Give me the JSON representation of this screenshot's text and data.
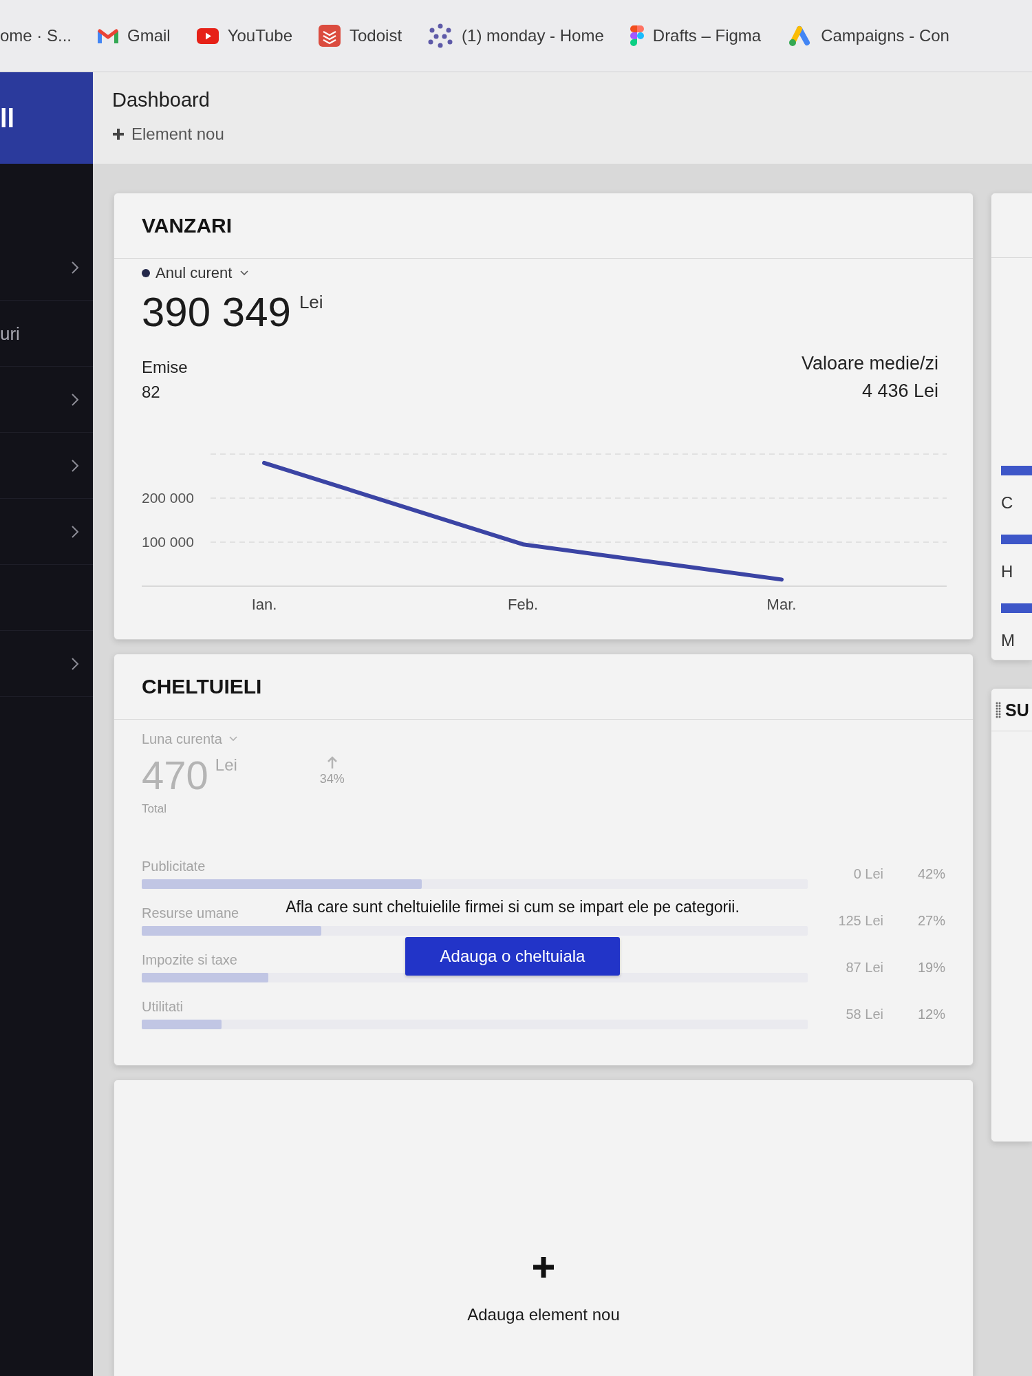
{
  "bookmarks": [
    {
      "kind": "plain",
      "label": "ome · S..."
    },
    {
      "kind": "mail",
      "label": "Gmail"
    },
    {
      "kind": "video",
      "label": "YouTube"
    },
    {
      "kind": "tasks",
      "label": "Todoist"
    },
    {
      "kind": "board",
      "label": "(1) monday - Home"
    },
    {
      "kind": "design",
      "label": "Drafts – Figma"
    },
    {
      "kind": "ads",
      "label": "Campaigns - Con"
    }
  ],
  "sidebar": {
    "brand": "ll",
    "items": [
      {
        "kind": "group"
      },
      {
        "kind": "link",
        "label": "uri"
      },
      {
        "kind": "group"
      },
      {
        "kind": "group"
      },
      {
        "kind": "group"
      },
      {
        "kind": "blank"
      },
      {
        "kind": "group"
      }
    ]
  },
  "header": {
    "title": "Dashboard",
    "add_label": "Element nou"
  },
  "sales": {
    "title": "VANZARI",
    "period": "Anul curent",
    "amount": "390 349",
    "currency": "Lei",
    "issued_label": "Emise",
    "issued_value": "82",
    "avg_label": "Valoare medie/zi",
    "avg_value": "4 436 Lei",
    "chart_data": {
      "type": "line",
      "categories": [
        "Ian.",
        "Feb.",
        "Mar."
      ],
      "values": [
        280000,
        95000,
        15000
      ],
      "ylim": [
        0,
        300000
      ],
      "yticks": [
        {
          "value": 100000,
          "label": "100 000"
        },
        {
          "value": 200000,
          "label": "200 000"
        }
      ]
    }
  },
  "expenses": {
    "title": "CHELTUIELI",
    "preview": {
      "period": "Luna curenta",
      "amount": "470",
      "currency": "Lei",
      "change": "34%",
      "total_label": "Total",
      "categories": [
        {
          "name": "Publicitate",
          "value": "0 Lei",
          "percent": "42%",
          "level": 0.42
        },
        {
          "name": "Resurse umane",
          "value": "125 Lei",
          "percent": "27%",
          "level": 0.27
        },
        {
          "name": "Impozite si taxe",
          "value": "87 Lei",
          "percent": "19%",
          "level": 0.19
        },
        {
          "name": "Utilitati",
          "value": "58 Lei",
          "percent": "12%",
          "level": 0.12
        }
      ]
    },
    "message": "Afla care sunt cheltuielile firmei si cum se impart ele pe categorii.",
    "button": "Adauga o cheltuiala"
  },
  "add_card": {
    "label": "Adauga element nou"
  },
  "right_column": {
    "top_card": {
      "items": [
        {
          "label": "C"
        },
        {
          "label": "H"
        },
        {
          "label": "M"
        }
      ]
    },
    "bottom_card": {
      "title": "SU"
    }
  }
}
